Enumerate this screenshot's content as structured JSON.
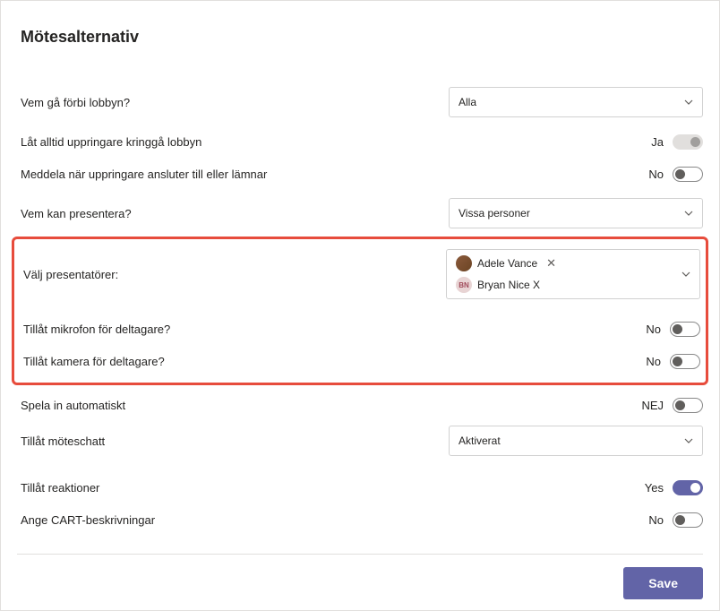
{
  "page_title": "Mötesalternativ",
  "options": {
    "lobby_bypass": {
      "label": "Vem gå förbi lobbyn?",
      "selected": "Alla"
    },
    "callers_bypass": {
      "label": "Låt alltid uppringare kringgå lobbyn",
      "value_label": "Ja",
      "enabled": false
    },
    "announce_callers": {
      "label": "Meddela när uppringare ansluter till eller lämnar",
      "value_label": "No",
      "on": false
    },
    "who_present": {
      "label": "Vem kan presentera?",
      "selected": "Vissa personer"
    },
    "choose_presenters": {
      "label": "Välj presentatörer:",
      "presenters": [
        {
          "name": "Adele Vance",
          "avatar_type": "photo",
          "initials": ""
        },
        {
          "name": "Bryan Nice X",
          "avatar_type": "initials",
          "initials": "BN"
        }
      ]
    },
    "allow_mic": {
      "label": "Tillåt mikrofon för deltagare?",
      "value_label": "No",
      "on": false
    },
    "allow_camera": {
      "label": "Tillåt kamera för deltagare?",
      "value_label": "No",
      "on": false
    },
    "auto_record": {
      "label": "Spela in automatiskt",
      "value_label": "NEJ",
      "on": false
    },
    "meeting_chat": {
      "label": "Tillåt möteschatt",
      "selected": "Aktiverat"
    },
    "reactions": {
      "label": "Tillåt reaktioner",
      "value_label": "Yes",
      "on": true
    },
    "cart_captions": {
      "label": "Ange CART-beskrivningar",
      "value_label": "No",
      "on": false
    }
  },
  "footer": {
    "save_label": "Save"
  }
}
